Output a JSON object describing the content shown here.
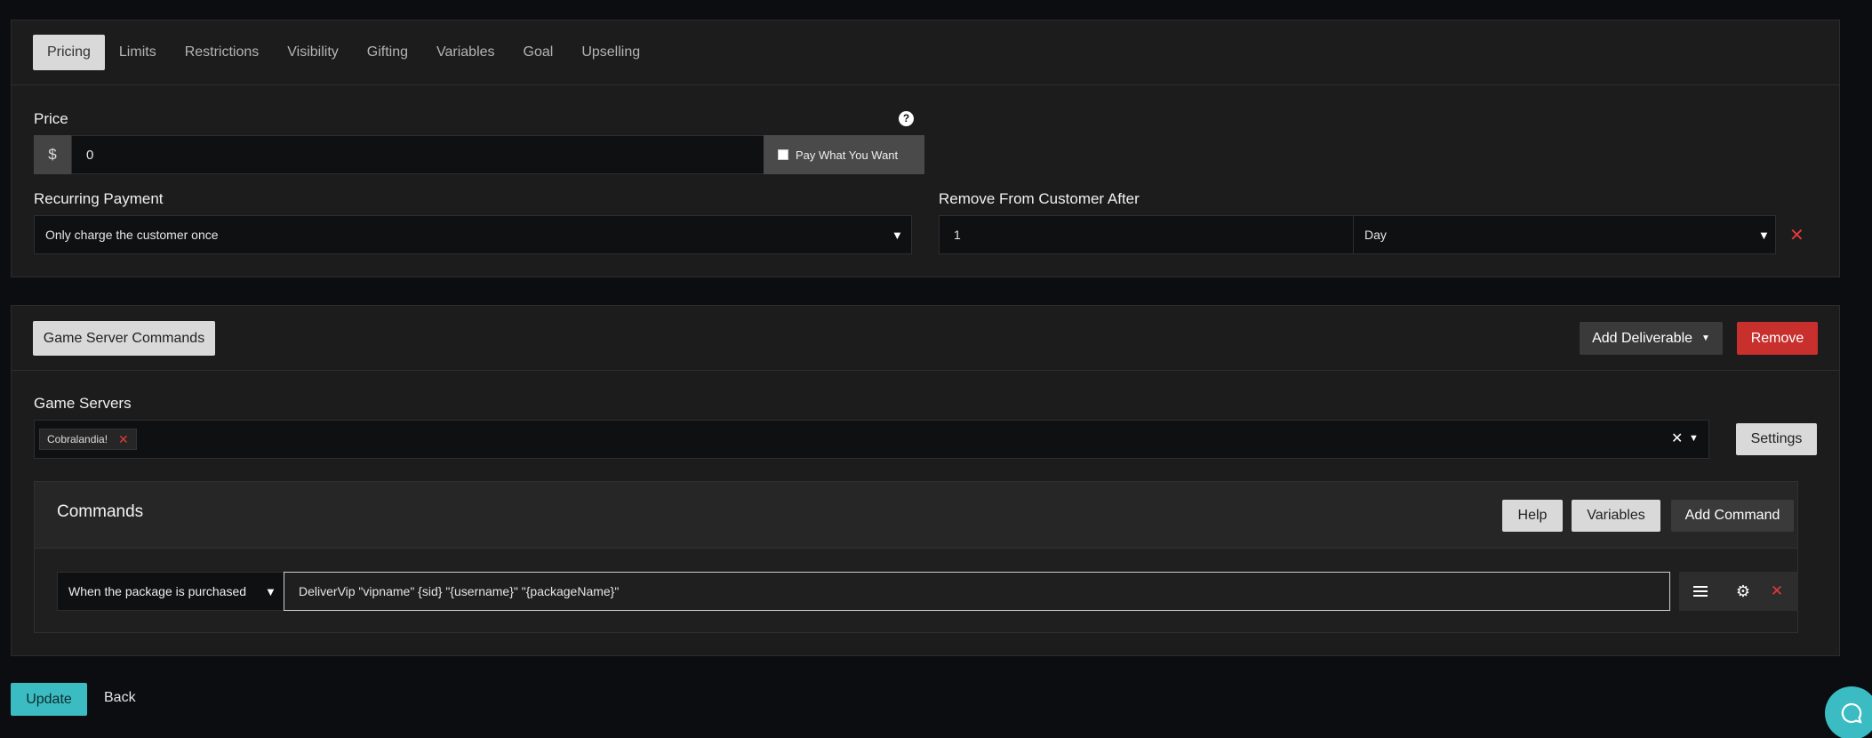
{
  "tabs": [
    "Pricing",
    "Limits",
    "Restrictions",
    "Visibility",
    "Gifting",
    "Variables",
    "Goal",
    "Upselling"
  ],
  "pricing": {
    "price_label": "Price",
    "help_icon": "?",
    "currency": "$",
    "price_value": "0",
    "pwyw_label": "Pay What You Want",
    "recurring_label": "Recurring Payment",
    "recurring_value": "Only charge the customer once",
    "remove_label": "Remove From Customer After",
    "remove_amount": "1",
    "remove_unit": "Day"
  },
  "deliverable": {
    "type_button": "Game Server Commands",
    "add_deliverable": "Add Deliverable",
    "remove": "Remove",
    "servers_label": "Game Servers",
    "server_tag": "Cobralandia!",
    "settings": "Settings",
    "commands_title": "Commands",
    "help": "Help",
    "variables": "Variables",
    "add_command": "Add Command",
    "trigger_value": "When the package is purchased",
    "command_value": "DeliverVip \"vipname\" {sid} \"{username}\" \"{packageName}\""
  },
  "footer": {
    "update": "Update",
    "back": "Back"
  },
  "colors": {
    "accent": "#3bbcc2",
    "danger": "#c7302d"
  }
}
